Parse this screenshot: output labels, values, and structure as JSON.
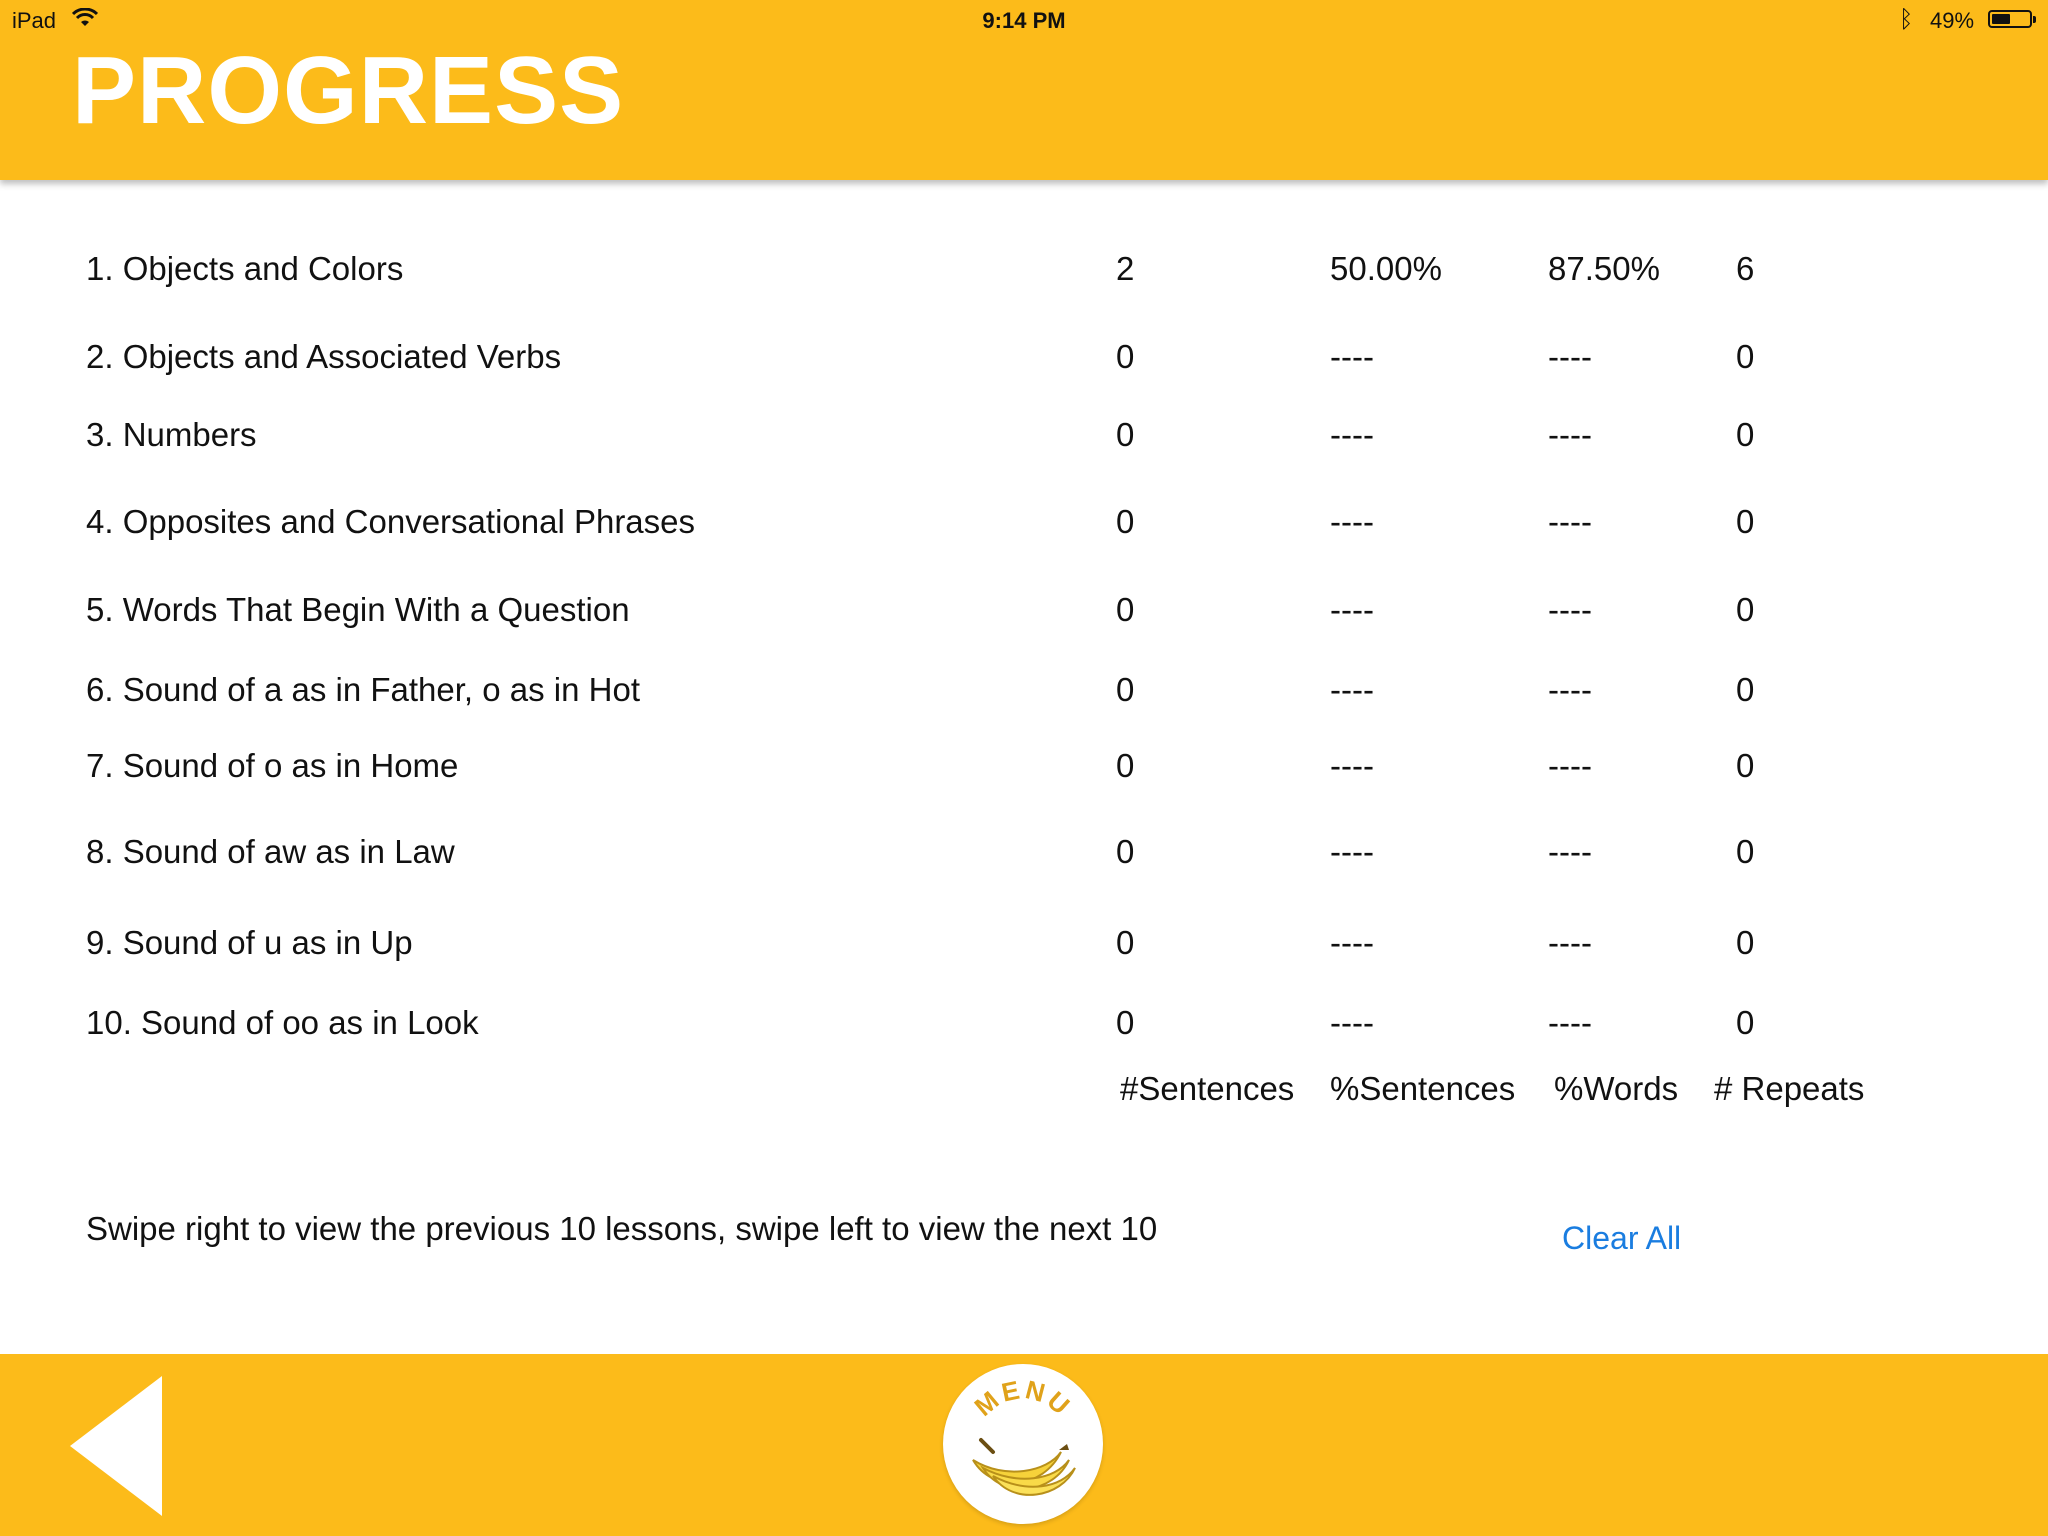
{
  "status_bar": {
    "device": "iPad",
    "time": "9:14 PM",
    "battery_percent": "49%",
    "battery_level": 0.49
  },
  "header": {
    "title": "PROGRESS"
  },
  "lessons": [
    {
      "name": "1. Objects and Colors",
      "sentences": "2",
      "pct_sentences": "50.00%",
      "pct_words": "87.50%",
      "repeats": "6"
    },
    {
      "name": "2. Objects and Associated Verbs",
      "sentences": "0",
      "pct_sentences": "----",
      "pct_words": "----",
      "repeats": "0"
    },
    {
      "name": "3. Numbers",
      "sentences": "0",
      "pct_sentences": "----",
      "pct_words": "----",
      "repeats": "0"
    },
    {
      "name": "4. Opposites and Conversational Phrases",
      "sentences": "0",
      "pct_sentences": "----",
      "pct_words": "----",
      "repeats": "0"
    },
    {
      "name": "5. Words That Begin With a Question",
      "sentences": "0",
      "pct_sentences": "----",
      "pct_words": "----",
      "repeats": "0"
    },
    {
      "name": "6. Sound of a as in Father, o as in Hot",
      "sentences": "0",
      "pct_sentences": "----",
      "pct_words": "----",
      "repeats": "0"
    },
    {
      "name": "7. Sound of o as in Home",
      "sentences": "0",
      "pct_sentences": "----",
      "pct_words": "----",
      "repeats": "0"
    },
    {
      "name": "8. Sound of aw as in Law",
      "sentences": "0",
      "pct_sentences": "----",
      "pct_words": "----",
      "repeats": "0"
    },
    {
      "name": "9. Sound of u as in Up",
      "sentences": "0",
      "pct_sentences": "----",
      "pct_words": "----",
      "repeats": "0"
    },
    {
      "name": "10. Sound of oo as in Look",
      "sentences": "0",
      "pct_sentences": "----",
      "pct_words": "----",
      "repeats": "0"
    }
  ],
  "columns": {
    "sentences": "#Sentences",
    "pct_sentences": "%Sentences",
    "pct_words": "%Words",
    "repeats": "# Repeats"
  },
  "swipe_hint": "Swipe right to view the previous 10 lessons, swipe left to view the next 10",
  "clear_all_label": "Clear All",
  "footer": {
    "back_icon": "back-triangle-icon",
    "menu_label": "MENU",
    "menu_icon": "banana-icon"
  },
  "colors": {
    "accent": "#FCBB1A",
    "link": "#1a7de0",
    "title_text": "#ffffff"
  }
}
